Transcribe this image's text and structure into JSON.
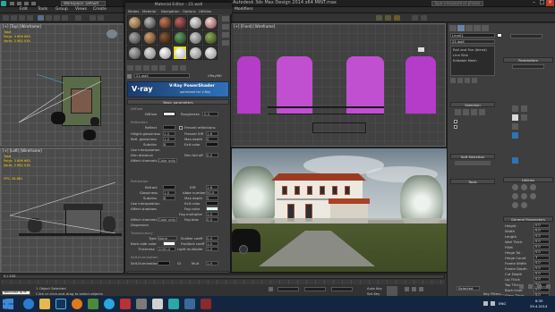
{
  "app": {
    "title": "Autodesk 3ds Max Design 2014 x64    MINT.max",
    "workspace": "Workspace: Default",
    "search_placeholder": "Type a keyword or phrase"
  },
  "menus": [
    "Edit",
    "Tools",
    "Group",
    "Views",
    "Create",
    "Modifiers"
  ],
  "viewports": {
    "top": {
      "label": "[+] [Top] [Wireframe]",
      "stats": [
        "Total",
        "Polys: 3 896 663",
        "Verts: 3 962 034"
      ]
    },
    "left": {
      "label": "[+] [Left] [Wireframe]",
      "stats": [
        "Total",
        "Polys: 3 896 663",
        "Verts: 3 962 034",
        "FPS: 28.861"
      ]
    },
    "front": {
      "label": "[+] [Front] [Wireframe]"
    }
  },
  "material_editor": {
    "title": "Material Editor - 21.wall",
    "menu": [
      "Modes",
      "Material",
      "Navigation",
      "Options",
      "Utilities"
    ],
    "name": "21.wall",
    "type": "VRayMtl",
    "banner": {
      "brand": "V·ray",
      "name": "V-Ray PowerShader",
      "sub": "optimized for V-Ray"
    },
    "sections": {
      "basic": "Basic parameters",
      "diffuse": "Diffuse",
      "reflection": "Reflection",
      "refraction": "Refraction",
      "translucency": "Translucency",
      "self_illum": "Self-illumination"
    },
    "labels": {
      "diffuse": "Diffuse",
      "roughness": "Roughness",
      "reflect": "Reflect",
      "hilight": "Hilight glossiness",
      "refl_gloss": "Refl. glossiness",
      "subdivs": "Subdivs",
      "use_interp": "Use interpolation",
      "dim_dist": "Dim distance",
      "affect_ch": "Affect channels",
      "fresnel": "Fresnel reflections",
      "fresnel_ior": "Fresnel IOR",
      "max_depth": "Max depth",
      "exit_color": "Exit color",
      "dim_falloff": "Dim fall off",
      "refract": "Refract",
      "glossiness": "Glossiness",
      "affect_shadows": "Affect shadows",
      "ior": "IOR",
      "abbe": "Abbe number",
      "max_depth2": "Max depth",
      "exit_color2": "Exit color",
      "fog_color": "Fog color",
      "fog_mult": "Fog multiplier",
      "fog_bias": "Fog bias",
      "dispersion": "Dispersion",
      "type": "Type",
      "back_side": "Back-side color",
      "thickness": "Thickness",
      "scatter": "Scatter coeff",
      "fwd_bck": "Fwd/bck coeff",
      "light_mult": "Light multiplier",
      "gi": "GI",
      "mult": "Mult"
    },
    "values": {
      "roughness": "0.0",
      "hilight": "1.0",
      "refl_gloss": "1.0",
      "subdivs": "8",
      "fresnel_ior": "1.6",
      "max_depth": "5",
      "dim_falloff": "0.0",
      "affect_color_only": "Color only",
      "glossiness": "1.0",
      "subdivs2": "8",
      "ior": "1.6",
      "abbe": "50.0",
      "max_depth2": "5",
      "fog_mult": "1.0",
      "fog_bias": "0.0",
      "trans_type": "None",
      "thickness": "1000.0",
      "scatter": "0.0",
      "fwd_bck": "1.0",
      "light_mult": "1.0",
      "mult": "1.0"
    },
    "rollouts": [
      "Options",
      "Maps",
      "Reflect interpolation",
      "Refract interpolation",
      "mental ray Connection"
    ]
  },
  "command_panel": {
    "dropdown": "21.wall",
    "object": "Line01",
    "stack": [
      "Rail and Fan (blend)",
      "Line Skin",
      "Editable Mesh"
    ],
    "sections": [
      "Parameters",
      "Selection",
      "Soft Selection",
      "Tools",
      "Utilities",
      "General Parameters"
    ],
    "parameter_labels": [
      "Height",
      "Width",
      "Length",
      "Wall Thick.",
      "Fillet",
      "Hinge Tol.",
      "Hinge Count",
      "Frame Width",
      "Frame Depth",
      "Cut Depth",
      "Lip Thick",
      "Top Thick",
      "Back Inset",
      "Glass Thick"
    ],
    "parameter_values": [
      "0.0",
      "0.0",
      "0.0",
      "0.0",
      "0.0",
      "0.0",
      "3",
      "0.0",
      "0.0",
      "0.0",
      "0.0",
      "0.0",
      "0.0",
      "0.0"
    ]
  },
  "status": {
    "left": "1 Object Selected",
    "sub": "Click or click-and-drag to select objects",
    "welcome": "Welcome to M",
    "auto_key": "Auto Key",
    "selected": "Selected",
    "set_key": "Set Key",
    "key_filters": "Key Filters...",
    "frame": "0 / 100"
  },
  "taskbar": {
    "time": "8:35",
    "date": "29.4.2014",
    "lang": "ENG"
  },
  "colors": {
    "accent": "#2e72b8",
    "magenta": "#b43cc8",
    "yellow": "#ffd200"
  }
}
